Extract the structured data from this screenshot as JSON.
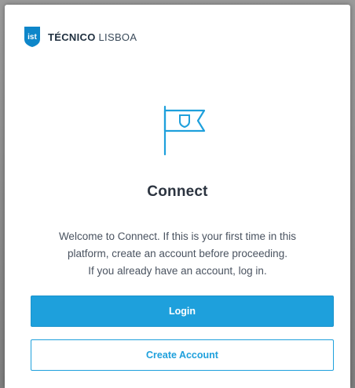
{
  "header": {
    "brand_strong": "TÉCNICO",
    "brand_light": "LISBOA",
    "logo_icon": "ist-shield-logo-icon"
  },
  "main": {
    "icon": "flag-icon",
    "title": "Connect",
    "welcome_lines": [
      "Welcome to Connect. If this is your first time in this",
      "platform, create an account before proceeding.",
      "If you already have an account, log in."
    ],
    "login_label": "Login",
    "create_account_label": "Create Account"
  },
  "colors": {
    "accent": "#1ea0dc",
    "logo_blue": "#0e86c9",
    "text_dark": "#2c3440"
  }
}
